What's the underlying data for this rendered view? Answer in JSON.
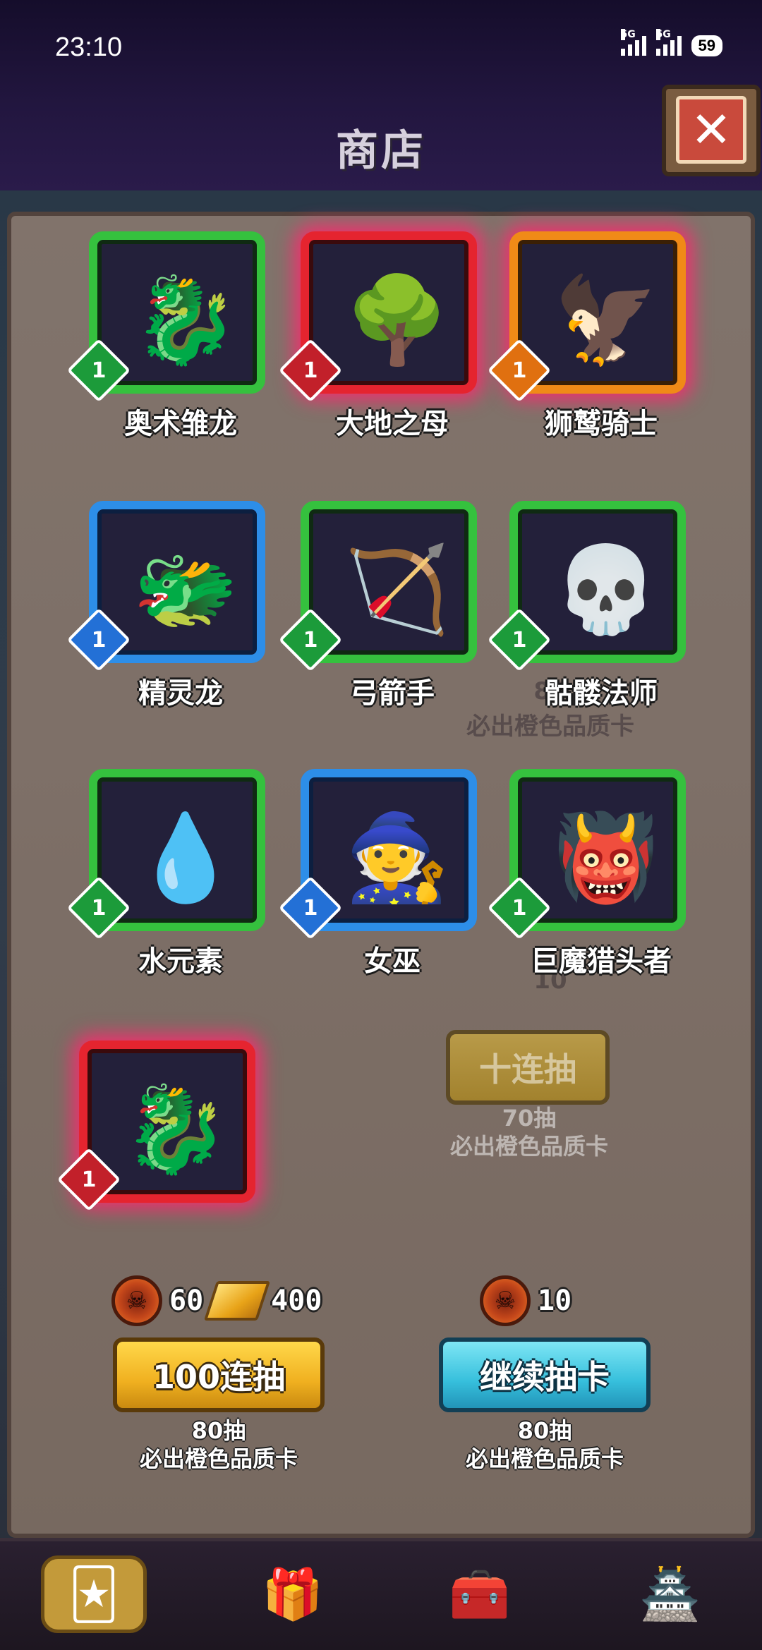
{
  "status_bar": {
    "time": "23:10",
    "signal1": "5G",
    "signal2": "5G",
    "battery": "59"
  },
  "header": {
    "title": "商店",
    "close_icon": "close-icon"
  },
  "cards": [
    {
      "name": "奥术雏龙",
      "level": "1",
      "rarity": "green",
      "icon": "dragon-icon",
      "glyph": "🐉"
    },
    {
      "name": "大地之母",
      "level": "1",
      "rarity": "red",
      "icon": "earth-mother-icon",
      "glyph": "🌳"
    },
    {
      "name": "狮鹫骑士",
      "level": "1",
      "rarity": "orange",
      "icon": "griffin-icon",
      "glyph": "🦅"
    },
    {
      "name": "精灵龙",
      "level": "1",
      "rarity": "blue",
      "icon": "fairy-dragon-icon",
      "glyph": "🐲"
    },
    {
      "name": "弓箭手",
      "level": "1",
      "rarity": "green",
      "icon": "archer-icon",
      "glyph": "🏹"
    },
    {
      "name": "骷髅法师",
      "level": "1",
      "rarity": "green",
      "icon": "skeleton-mage-icon",
      "glyph": "💀"
    },
    {
      "name": "水元素",
      "level": "1",
      "rarity": "green",
      "icon": "water-elemental-icon",
      "glyph": "💧"
    },
    {
      "name": "女巫",
      "level": "1",
      "rarity": "blue",
      "icon": "witch-icon",
      "glyph": "🧙"
    },
    {
      "name": "巨魔猎头者",
      "level": "1",
      "rarity": "green",
      "icon": "troll-icon",
      "glyph": "👹"
    },
    {
      "name": "",
      "level": "1",
      "rarity": "red",
      "icon": "blue-dragon-icon",
      "glyph": "🐉"
    }
  ],
  "background": {
    "ghost_pity_count": "80",
    "ghost_pity_text": "必出橙色品质卡",
    "ten_draw": {
      "count": "10",
      "label": "十连抽",
      "pity_count": "70抽",
      "pity_text": "必出橙色品质卡"
    }
  },
  "draw_left": {
    "coin_amount": "60",
    "gold_amount": "400",
    "button_label": "100连抽",
    "pity_count": "80抽",
    "pity_text": "必出橙色品质卡"
  },
  "draw_right": {
    "coin_amount": "10",
    "button_label": "继续抽卡",
    "pity_count": "80抽",
    "pity_text": "必出橙色品质卡"
  },
  "nav": [
    {
      "icon": "card-deck-icon",
      "glyph": "🃏",
      "active": true
    },
    {
      "icon": "gift-box-icon",
      "glyph": "🎁",
      "active": false
    },
    {
      "icon": "treasure-chest-icon",
      "glyph": "🧰",
      "active": false
    },
    {
      "icon": "barracks-icon",
      "glyph": "🏯",
      "active": false
    }
  ],
  "colors": {
    "green": "#35c13e",
    "blue": "#2d8ee8",
    "red": "#e5242f",
    "orange": "#f08a17"
  }
}
